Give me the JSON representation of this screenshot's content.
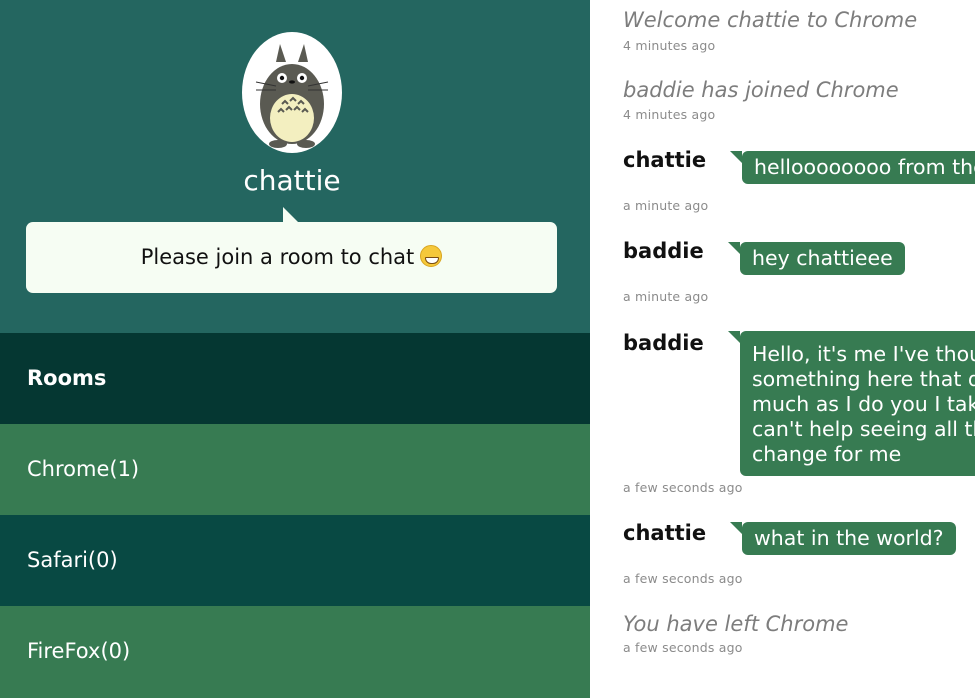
{
  "profile": {
    "username": "chattie",
    "avatar_alt": "totoro-avatar",
    "notice": "Please join a room to chat"
  },
  "rooms": {
    "header": "Rooms",
    "items": [
      {
        "label": "Chrome(1)"
      },
      {
        "label": "Safari(0)"
      },
      {
        "label": "FireFox(0)"
      }
    ]
  },
  "chat": {
    "messages": [
      {
        "kind": "system",
        "text": "Welcome chattie to Chrome",
        "time": "4 minutes ago"
      },
      {
        "kind": "system",
        "text": "baddie has joined Chrome",
        "time": "4 minutes ago"
      },
      {
        "kind": "user",
        "sender": "chattie",
        "text": "helloooooooo from the",
        "time": "a minute ago"
      },
      {
        "kind": "user",
        "sender": "baddie",
        "text": "hey chattieee",
        "time": "a minute ago"
      },
      {
        "kind": "user",
        "sender": "baddie",
        "lines": [
          "Hello, it's me I've thoug",
          "something here that do",
          "much as I do you I take",
          "can't help seeing all th",
          "change for me"
        ],
        "time": "a few seconds ago"
      },
      {
        "kind": "user",
        "sender": "chattie",
        "text": "what in the world?",
        "time": "a few seconds ago"
      },
      {
        "kind": "system",
        "text": "You have left Chrome",
        "time": "a few seconds ago"
      }
    ]
  },
  "colors": {
    "profile_bg": "#246660",
    "rooms_header_bg": "#053732",
    "room_light": "#377b52",
    "room_dark": "#084943",
    "bubble": "#377b52",
    "notice_bg": "#f6fdf3"
  },
  "icons": {
    "avatar": "totoro-icon",
    "emoji": "grinning-face-icon"
  }
}
